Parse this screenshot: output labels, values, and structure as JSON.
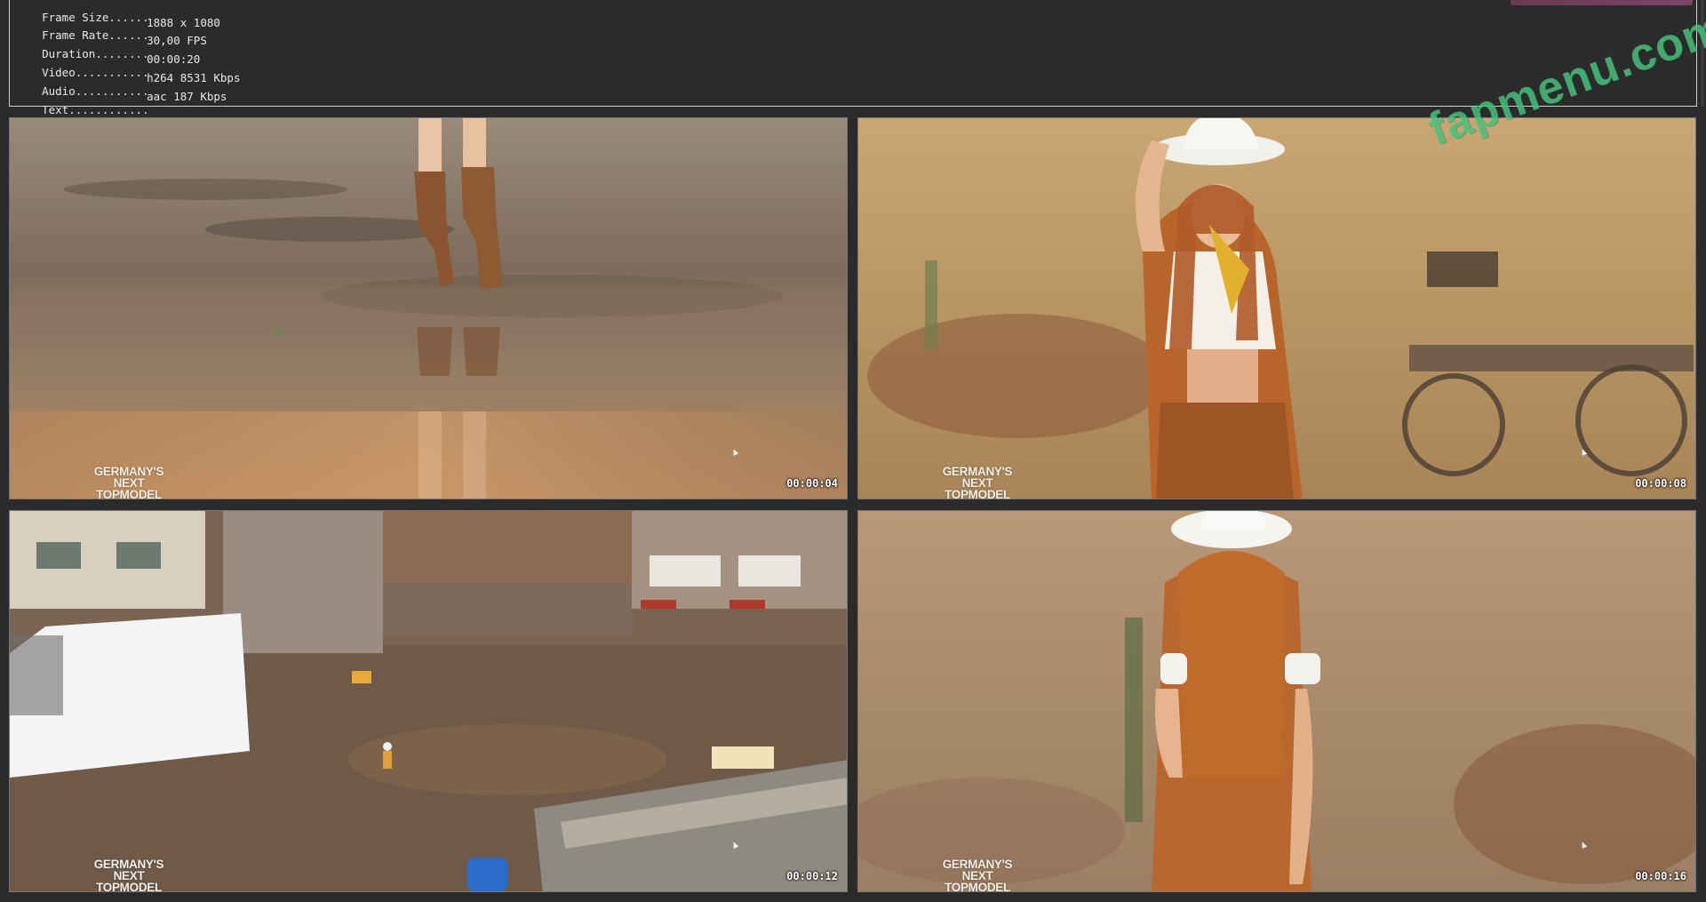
{
  "info_panel": {
    "rows": [
      {
        "label": "Frame Size",
        "value": "1888 x 1080"
      },
      {
        "label": "Frame Rate",
        "value": "30,00 FPS"
      },
      {
        "label": "Duration",
        "value": "00:00:20"
      },
      {
        "label": "Video",
        "value": "h264 8531 Kbps"
      },
      {
        "label": "Audio",
        "value": "aac 187 Kbps"
      },
      {
        "label": "Text",
        "value": "..........................................................................."
      }
    ]
  },
  "logo": {
    "line1": "GERMANY'S",
    "line2": "NEXT",
    "line3": "TOPMODEL"
  },
  "frames": [
    {
      "timestamp": "00:00:04"
    },
    {
      "timestamp": "00:00:08"
    },
    {
      "timestamp": "00:00:12"
    },
    {
      "timestamp": "00:00:16"
    }
  ],
  "watermark": "fapmenu.com",
  "colors": {
    "background": "#2b2b2b",
    "panel_border": "#cfcfcf",
    "watermark": "#4cc982",
    "text": "#e8e8e8"
  }
}
